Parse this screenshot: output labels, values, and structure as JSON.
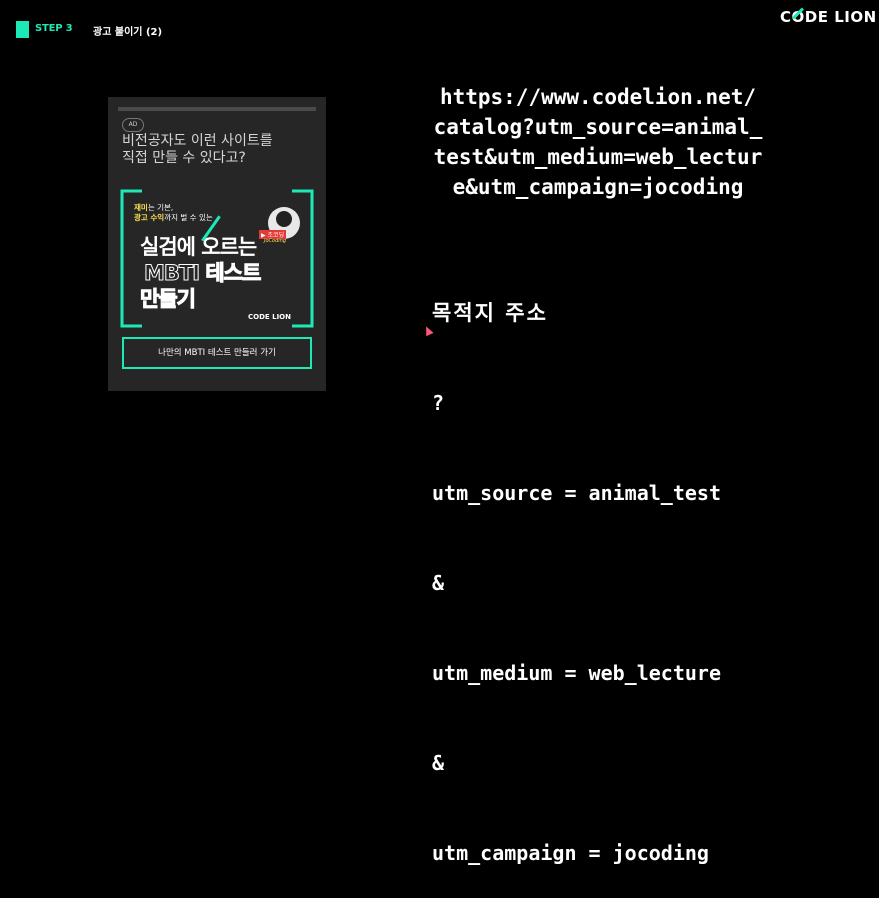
{
  "header": {
    "step_label": "STEP 3",
    "step_title": "광고 붙이기 (2)",
    "brand_c": "C",
    "brand_o": "O",
    "brand_rest": "DE LION"
  },
  "ad": {
    "badge": "AD",
    "headline_line1": "비전공자도 이런 사이트를",
    "headline_line2": "직접 만들 수 있다고?",
    "sub1_highlight": "재미",
    "sub1_rest": "는 기본,",
    "sub2_highlight": "광고 수익",
    "sub2_rest": "까지 벌 수 있는",
    "title_line1": "실검에 오르는",
    "title_line2": "MBTI 테스트",
    "title_line3": "만들기",
    "youtube_channel": "조코딩",
    "youtube_sub": "JoCoding",
    "logo": "CODE LION",
    "cta": "나만의 MBTI 테스트 만들러 가기"
  },
  "content": {
    "url_lines": [
      "https://www.codelion.net/",
      "catalog?utm_source=animal_",
      "test&utm_medium=web_lectur",
      "e&utm_campaign=jocoding"
    ],
    "heading": "목적지 주소",
    "params": [
      "?",
      "utm_source = animal_test",
      "&",
      "utm_medium = web_lecture",
      "&",
      "utm_campaign = jocoding"
    ]
  },
  "colors": {
    "accent": "#1de9b6",
    "background": "#000000",
    "ad_background": "#262626",
    "highlight": "#ffe14d"
  }
}
